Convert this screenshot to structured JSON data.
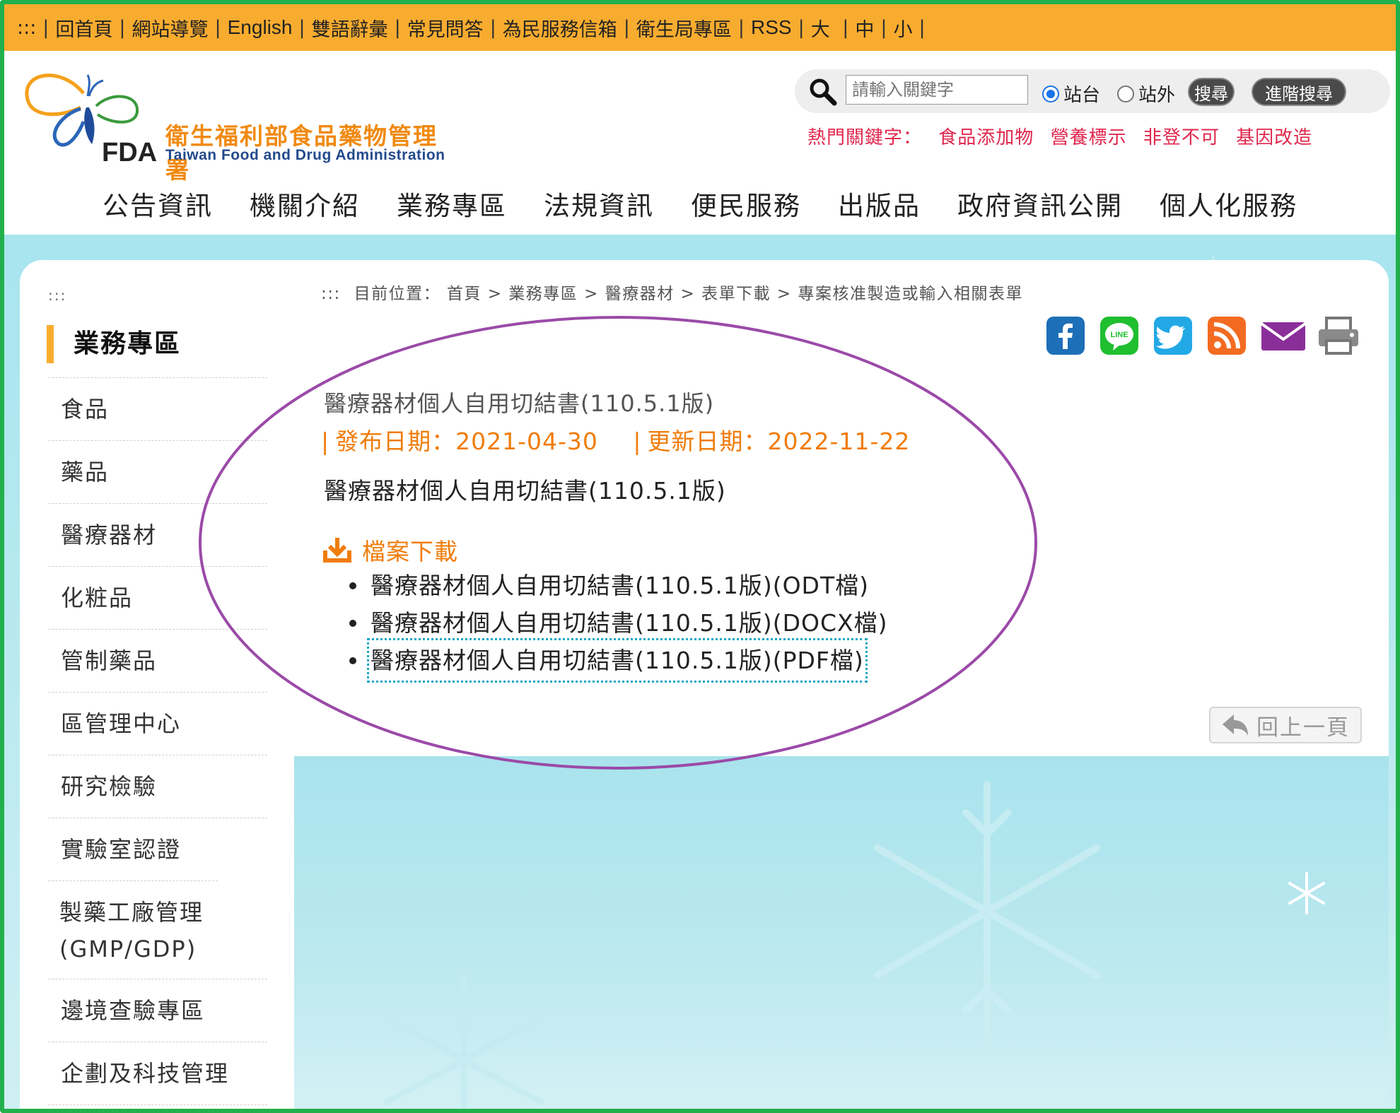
{
  "topbar": {
    "items": [
      ":::",
      "回首頁",
      "網站導覽",
      "English",
      "雙語辭彙",
      "常見問答",
      "為民服務信箱",
      "衛生局專區",
      "RSS",
      "大",
      "中",
      "小"
    ]
  },
  "logo": {
    "zh": "衛生福利部食品藥物管理署",
    "en": "Taiwan Food and Drug Administration",
    "abbr": "FDA"
  },
  "search": {
    "placeholder": "請輸入關鍵字",
    "radio_site": "站台",
    "radio_external": "站外",
    "search_button": "搜尋",
    "advanced_button": "進階搜尋"
  },
  "hot_keywords": {
    "label": "熱門關鍵字：",
    "items": [
      "食品添加物",
      "營養標示",
      "非登不可",
      "基因改造"
    ]
  },
  "main_nav": [
    "公告資訊",
    "機關介紹",
    "業務專區",
    "法規資訊",
    "便民服務",
    "出版品",
    "政府資訊公開",
    "個人化服務"
  ],
  "sidebar": {
    "marker": ":::",
    "title": "業務專區",
    "items": [
      "食品",
      "藥品",
      "醫療器材",
      "化粧品",
      "管制藥品",
      "區管理中心",
      "研究檢驗",
      "實驗室認證",
      "製藥工廠管理(GMP/GDP)",
      "邊境查驗專區",
      "企劃及科技管理"
    ]
  },
  "breadcrumb": {
    "marker": ":::",
    "label": "目前位置：",
    "items": [
      "首頁",
      "業務專區",
      "醫療器材",
      "表單下載",
      "專案核准製造或輸入相關表單"
    ]
  },
  "social_icons": [
    "facebook-icon",
    "line-icon",
    "twitter-icon",
    "rss-icon",
    "email-icon",
    "print-icon"
  ],
  "document": {
    "title": "醫療器材個人自用切結書(110.5.1版)",
    "publish_label": "發布日期：",
    "publish_date": "2021-04-30",
    "update_label": "更新日期：",
    "update_date": "2022-11-22",
    "description": "醫療器材個人自用切結書(110.5.1版)",
    "download_heading": "檔案下載",
    "files": [
      "醫療器材個人自用切結書(110.5.1版)(ODT檔)",
      "醫療器材個人自用切結書(110.5.1版)(DOCX檔)",
      "醫療器材個人自用切結書(110.5.1版)(PDF檔)"
    ]
  },
  "back_button": "回上一頁",
  "colors": {
    "topbar": "#f8ac2f",
    "accent_orange": "#f07c0a",
    "hot_keyword_red": "#e0264c",
    "frame_green": "#22b04c",
    "annotation_purple": "#9b4aa8"
  }
}
